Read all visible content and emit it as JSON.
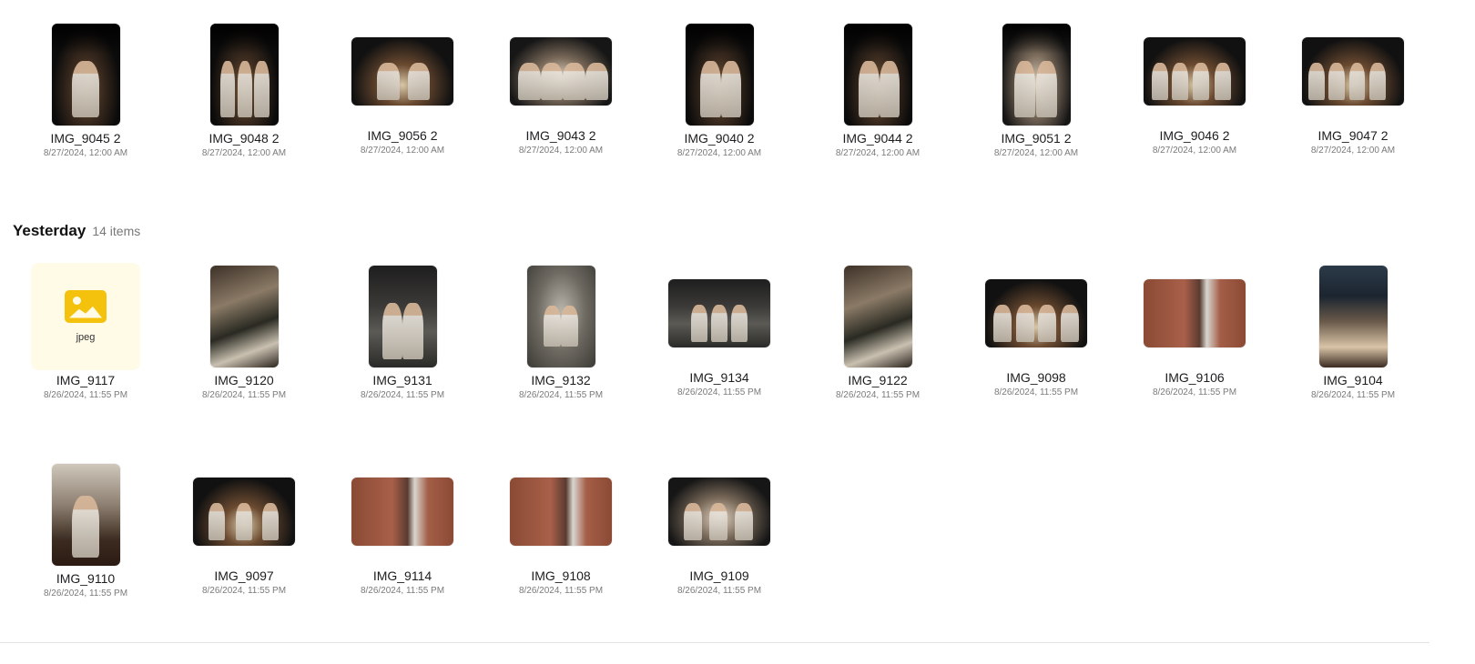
{
  "rows": [
    {
      "items": [
        {
          "name": "IMG_9045 2",
          "date": "8/27/2024, 12:00 AM"
        },
        {
          "name": "IMG_9048 2",
          "date": "8/27/2024, 12:00 AM"
        },
        {
          "name": "IMG_9056 2",
          "date": "8/27/2024, 12:00 AM"
        },
        {
          "name": "IMG_9043 2",
          "date": "8/27/2024, 12:00 AM"
        },
        {
          "name": "IMG_9040 2",
          "date": "8/27/2024, 12:00 AM"
        },
        {
          "name": "IMG_9044 2",
          "date": "8/27/2024, 12:00 AM"
        },
        {
          "name": "IMG_9051 2",
          "date": "8/27/2024, 12:00 AM"
        },
        {
          "name": "IMG_9046 2",
          "date": "8/27/2024, 12:00 AM"
        },
        {
          "name": "IMG_9047 2",
          "date": "8/27/2024, 12:00 AM"
        }
      ]
    },
    {
      "items": [
        {
          "name": "IMG_9117",
          "date": "8/26/2024, 11:55 PM"
        },
        {
          "name": "IMG_9120",
          "date": "8/26/2024, 11:55 PM"
        },
        {
          "name": "IMG_9131",
          "date": "8/26/2024, 11:55 PM"
        },
        {
          "name": "IMG_9132",
          "date": "8/26/2024, 11:55 PM"
        },
        {
          "name": "IMG_9134",
          "date": "8/26/2024, 11:55 PM"
        },
        {
          "name": "IMG_9122",
          "date": "8/26/2024, 11:55 PM"
        },
        {
          "name": "IMG_9098",
          "date": "8/26/2024, 11:55 PM"
        },
        {
          "name": "IMG_9106",
          "date": "8/26/2024, 11:55 PM"
        },
        {
          "name": "IMG_9104",
          "date": "8/26/2024, 11:55 PM"
        }
      ]
    },
    {
      "items": [
        {
          "name": "IMG_9110",
          "date": "8/26/2024, 11:55 PM"
        },
        {
          "name": "IMG_9097",
          "date": "8/26/2024, 11:55 PM"
        },
        {
          "name": "IMG_9114",
          "date": "8/26/2024, 11:55 PM"
        },
        {
          "name": "IMG_9108",
          "date": "8/26/2024, 11:55 PM"
        },
        {
          "name": "IMG_9109",
          "date": "8/26/2024, 11:55 PM"
        }
      ]
    }
  ],
  "section": {
    "title": "Yesterday",
    "count": "14 items"
  },
  "placeholder": {
    "label": "jpeg",
    "icon": "image-icon"
  },
  "colors": {
    "placeholder_bg": "#fffbe6",
    "placeholder_icon": "#f4c20d"
  }
}
